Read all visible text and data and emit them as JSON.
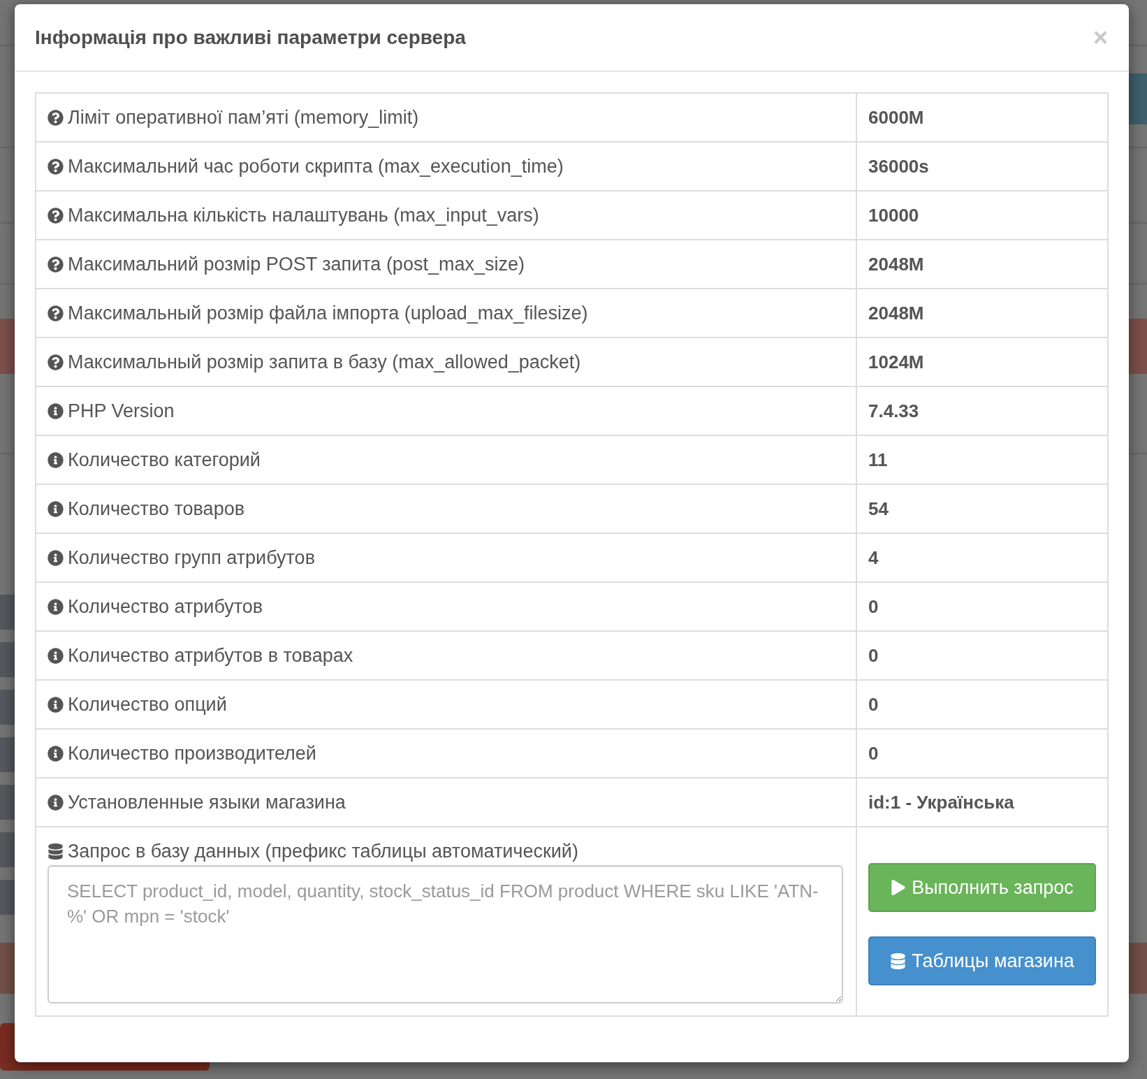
{
  "modal": {
    "title": "Інформація про важливі параметри сервера",
    "close": "×"
  },
  "rows": [
    {
      "kind": "help",
      "label": "Ліміт оперативної пам’яті (memory_limit)",
      "value": "6000M"
    },
    {
      "kind": "help",
      "label": "Максимальний час роботи скрипта (max_execution_time)",
      "value": "36000s"
    },
    {
      "kind": "help",
      "label": "Максимальна кількість налаштувань (max_input_vars)",
      "value": "10000"
    },
    {
      "kind": "help",
      "label": "Максимальний розмір POST запита (post_max_size)",
      "value": "2048M"
    },
    {
      "kind": "help",
      "label": "Максимальный розмір файла імпорта (upload_max_filesize)",
      "value": "2048M"
    },
    {
      "kind": "help",
      "label": "Максимальный розмір запита в базу (max_allowed_packet)",
      "value": "1024M"
    },
    {
      "kind": "info",
      "label": "PHP Version",
      "value": "7.4.33"
    },
    {
      "kind": "info",
      "label": "Количество категорий",
      "value": "11"
    },
    {
      "kind": "info",
      "label": "Количество товаров",
      "value": "54"
    },
    {
      "kind": "info",
      "label": "Количество групп атрибутов",
      "value": "4"
    },
    {
      "kind": "info",
      "label": "Количество атрибутов",
      "value": "0"
    },
    {
      "kind": "info",
      "label": "Количество атрибутов в товарах",
      "value": "0"
    },
    {
      "kind": "info",
      "label": "Количество опций",
      "value": "0"
    },
    {
      "kind": "info",
      "label": "Количество производителей",
      "value": "0"
    },
    {
      "kind": "info",
      "label": "Установленные языки магазина",
      "value": "id:1 - Українська"
    }
  ],
  "query": {
    "label": "Запрос в базу данных (префикс таблицы автоматический)",
    "placeholder": "SELECT product_id, model, quantity, stock_status_id FROM product WHERE sku LIKE 'ATN-%' OR mpn = 'stock'"
  },
  "buttons": [
    {
      "kind": "run",
      "label": "Выполнить запрос"
    },
    {
      "kind": "tables",
      "label": "Таблицы магазина"
    }
  ]
}
